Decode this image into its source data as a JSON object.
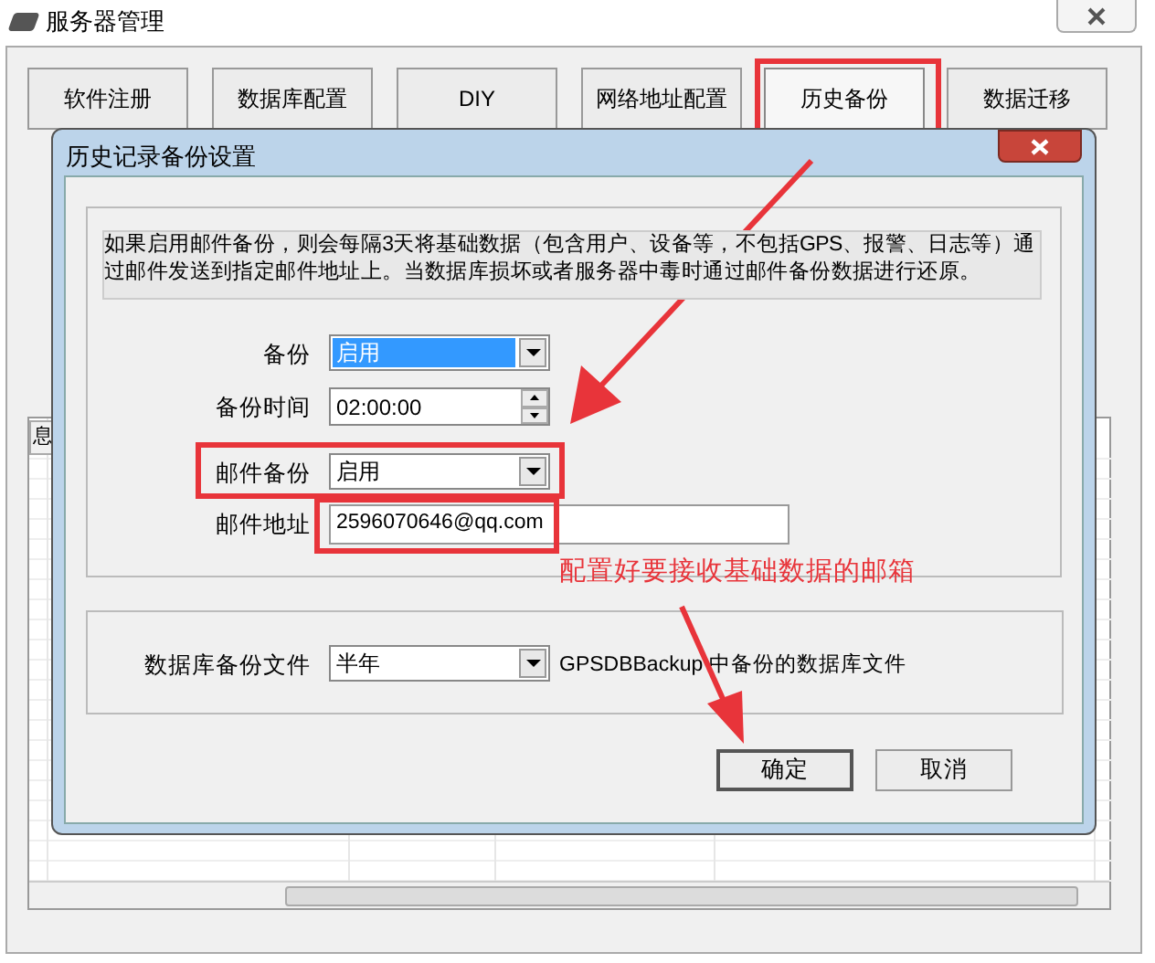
{
  "window": {
    "title": "服务器管理"
  },
  "tabs": [
    {
      "label": "软件注册",
      "selected": false
    },
    {
      "label": "数据库配置",
      "selected": false
    },
    {
      "label": "DIY",
      "selected": false
    },
    {
      "label": "网络地址配置",
      "selected": false
    },
    {
      "label": "历史备份",
      "selected": true
    },
    {
      "label": "数据迁移",
      "selected": false
    }
  ],
  "grid": {
    "header_fragment": "息"
  },
  "dialog": {
    "title": "历史记录备份设置",
    "description": "如果启用邮件备份，则会每隔3天将基础数据（包含用户、设备等，不包括GPS、报警、日志等）通过邮件发送到指定邮件地址上。当数据库损坏或者服务器中毒时通过邮件备份数据进行还原。",
    "fields": [
      {
        "kind": "combo",
        "label": "备份",
        "value": "启用",
        "selected": true
      },
      {
        "kind": "time",
        "label": "备份时间",
        "value": "02:00:00"
      },
      {
        "kind": "combo",
        "label": "邮件备份",
        "value": "启用",
        "selected": false
      },
      {
        "kind": "text",
        "label": "邮件地址",
        "value": "2596070646@qq.com"
      }
    ],
    "db_backup": {
      "label": "数据库备份文件",
      "value": "半年",
      "note": "GPSDBBackup 中备份的数据库文件"
    },
    "buttons": [
      {
        "label": "确定",
        "default": true
      },
      {
        "label": "取消",
        "default": false
      }
    ]
  },
  "annotation": {
    "text": "配置好要接收基础数据的邮箱"
  }
}
